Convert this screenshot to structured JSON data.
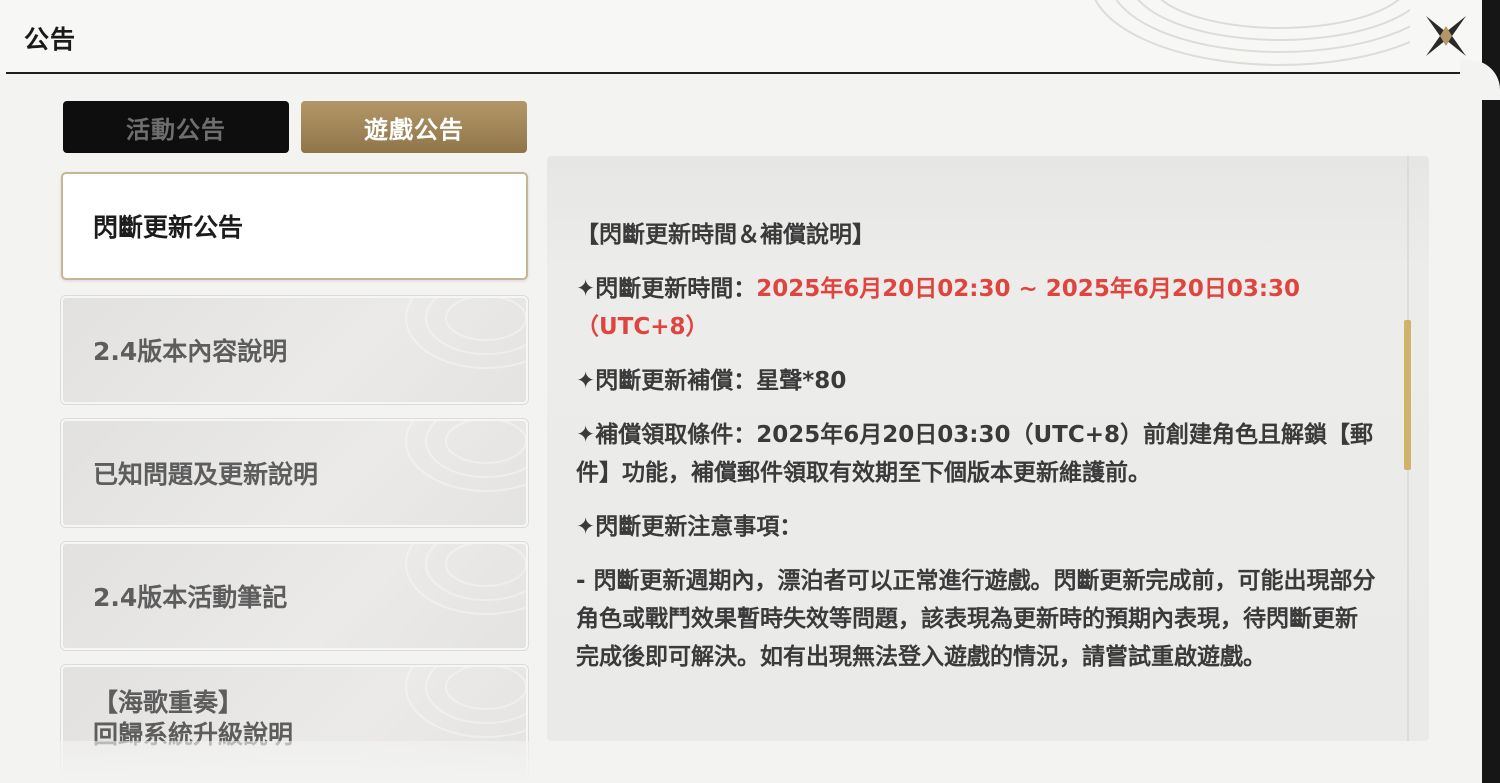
{
  "header": {
    "title": "公告"
  },
  "tabs": [
    {
      "label": "活動公告",
      "active": false
    },
    {
      "label": "遊戲公告",
      "active": true
    }
  ],
  "sidebar": {
    "items": [
      {
        "label": "閃斷更新公告",
        "active": true
      },
      {
        "label": "2.4版本內容說明",
        "active": false
      },
      {
        "label": "已知問題及更新說明",
        "active": false
      },
      {
        "label": "2.4版本活動筆記",
        "active": false
      },
      {
        "label_line1": "【海歌重奏】",
        "label_line2": "回歸系統升級說明",
        "active": false
      }
    ]
  },
  "article": {
    "heading": "【閃斷更新時間＆補償說明】",
    "time_label": "✦閃斷更新時間：",
    "time_value": "2025年6月20日02:30 ~ 2025年6月20日03:30（UTC+8）",
    "comp_label": "✦閃斷更新補償：",
    "comp_value": "星聲*80",
    "cond_text": "✦補償領取條件：2025年6月20日03:30（UTC+8）前創建角色且解鎖【郵件】功能，補償郵件領取有效期至下個版本更新維護前。",
    "notes_label": "✦閃斷更新注意事項：",
    "note_1": "- 閃斷更新週期內，漂泊者可以正常進行遊戲。閃斷更新完成前，可能出現部分角色或戰鬥效果暫時失效等問題，該表現為更新時的預期內表現，待閃斷更新完成後即可解決。如有出現無法登入遊戲的情況，請嘗試重啟遊戲。"
  },
  "colors": {
    "accent_gold": "#b39769",
    "highlight_red": "#e0443e",
    "scroll_thumb": "#cfb36a"
  }
}
